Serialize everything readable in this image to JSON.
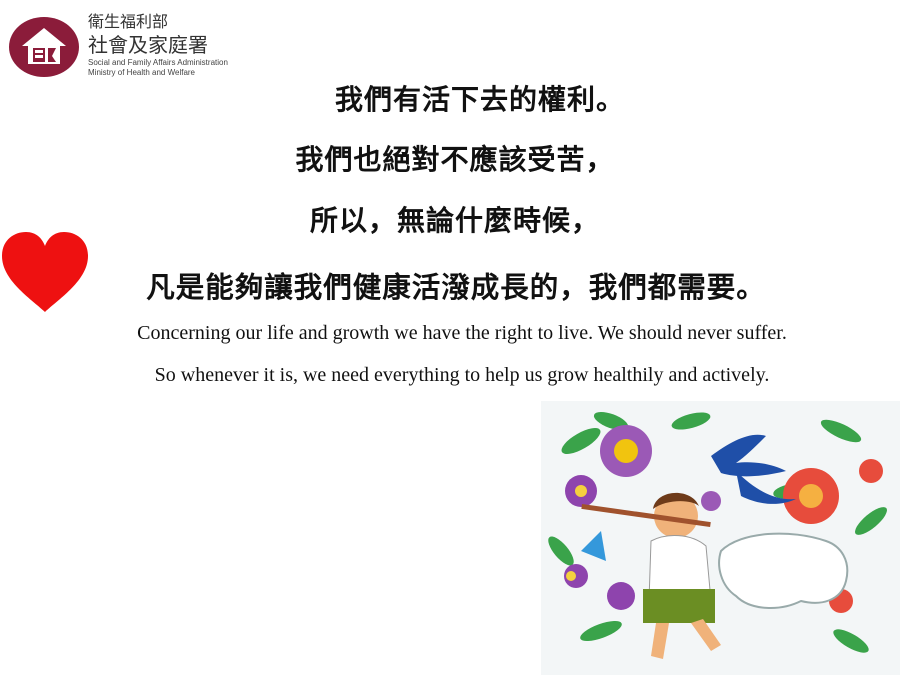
{
  "logo": {
    "line1": "衛生福利部",
    "line2": "社會及家庭署",
    "line3": "Social and Family Affairs Administration",
    "line4": "Ministry of Health and Welfare",
    "brand_color": "#8b1c3a"
  },
  "chinese_lines": [
    "我們有活下去的權利。",
    "我們也絕對不應該受苦，",
    "所以，無論什麼時候，",
    "凡是能夠讓我們健康活潑成長的，我們都需要。"
  ],
  "english_lines": [
    "Concerning our life and growth we have the right to live. We should never suffer.",
    "So whenever it is, we need everything to help us grow healthily and actively."
  ],
  "heart_color": "#ee1111"
}
